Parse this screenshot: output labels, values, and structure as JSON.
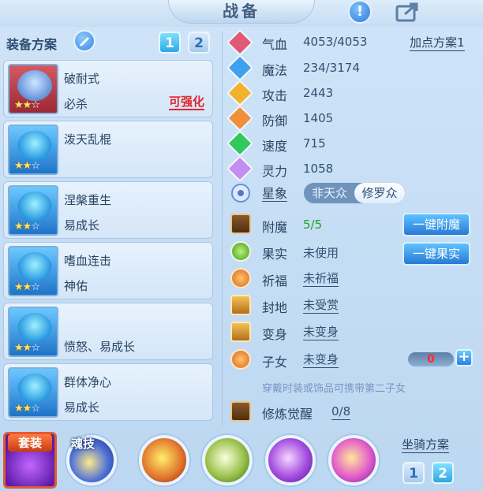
{
  "header": {
    "title": "战备",
    "info_icon": "!"
  },
  "left": {
    "scheme_label": "装备方案",
    "scheme_buttons": [
      "1",
      "2"
    ],
    "cards": [
      {
        "name": "破耐式",
        "attr": "必杀",
        "tag": "可强化",
        "stars": 2,
        "max_stars": 3,
        "theme": "red"
      },
      {
        "name": "泼天乱棍",
        "attr": "",
        "tag": "",
        "stars": 2,
        "max_stars": 3,
        "theme": "blue"
      },
      {
        "name": "涅槃重生",
        "attr": "易成长",
        "tag": "",
        "stars": 2,
        "max_stars": 3,
        "theme": "blue"
      },
      {
        "name": "嗜血连击",
        "attr": "神佑",
        "tag": "",
        "stars": 2,
        "max_stars": 3,
        "theme": "blue"
      },
      {
        "name": "",
        "attr": "愤怒、易成长",
        "tag": "",
        "stars": 2,
        "max_stars": 3,
        "theme": "blue"
      },
      {
        "name": "群体净心",
        "attr": "易成长",
        "tag": "",
        "stars": 2,
        "max_stars": 3,
        "theme": "blue"
      }
    ]
  },
  "stats": {
    "add_point_plan": "加点方案1",
    "rows": [
      {
        "label": "气血",
        "value": "4053/4053",
        "color": "#e05a78"
      },
      {
        "label": "魔法",
        "value": "234/3174",
        "color": "#3fa0ee"
      },
      {
        "label": "攻击",
        "value": "2443",
        "color": "#f2b22e"
      },
      {
        "label": "防御",
        "value": "1405",
        "color": "#f0903a"
      },
      {
        "label": "速度",
        "value": "715",
        "color": "#32c85e"
      },
      {
        "label": "灵力",
        "value": "1058",
        "color": "#c48ef0"
      }
    ],
    "star_sign": {
      "label": "星象",
      "option_off": "非天众",
      "option_on": "修罗众"
    }
  },
  "extras": {
    "enchant": {
      "label": "附魔",
      "value": "5/5",
      "button": "一键附魔"
    },
    "fruit": {
      "label": "果实",
      "value": "未使用",
      "button": "一键果实"
    },
    "blessing": {
      "label": "祈福",
      "value": "未祈福"
    },
    "fief": {
      "label": "封地",
      "value": "未受赏"
    },
    "transform": {
      "label": "变身",
      "value": "未变身"
    },
    "children": {
      "label": "子女",
      "value": "未变身",
      "count": "0",
      "plus": "+"
    },
    "hint": "穿戴时装或饰品可携带第二子女",
    "cultivation": {
      "label": "修炼觉醒",
      "value": "0/8"
    }
  },
  "bottom": {
    "suit_label": "套装",
    "soul_label": "魂技",
    "mount_label": "坐骑方案",
    "mount_buttons": [
      "1",
      "2"
    ]
  }
}
